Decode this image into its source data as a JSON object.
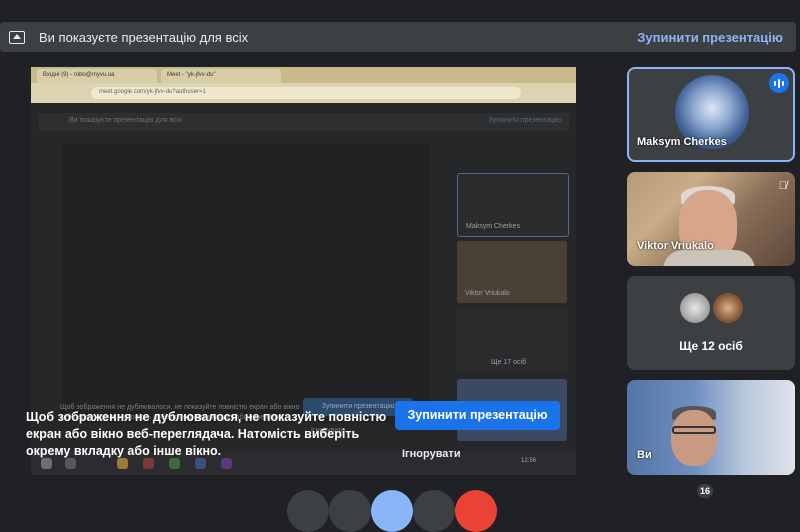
{
  "banner": {
    "text": "Ви показуєте презентацію для всіх",
    "stop_label": "Зупинити презентацію"
  },
  "shared_screen": {
    "tabs": [
      "Вхідні (9) - robo@myvu.ua",
      "Meet - \"yk-jfvv-du\""
    ],
    "url": "meet.google.com/yk-jfvv-du?authuser=1",
    "inner_banner_text": "Ви показуєте презентацію для всіх",
    "inner_stop_label": "Зупинити презентацію",
    "inner_tiles": [
      "Maksym Cherkes",
      "Viktor Vriukalo",
      "Ще 17 осіб",
      ""
    ],
    "inner_message": "Щоб зображення не дублювалося, не показуйте повністю екран або вікно веб-переглядача. Натомість виберіть окрему вкладку або інше вікно.",
    "inner_button": "Зупинити презентацію",
    "inner_ignore": "Ігнорувати",
    "clock": "12:56"
  },
  "overlay": {
    "message": "Щоб зображення не дублювалося, не показуйте повністю екран або вікно веб-переглядача. Натомість виберіть окрему вкладку або інше вікно.",
    "stop_button": "Зупинити презентацію",
    "ignore": "Ігнорувати"
  },
  "participants": [
    {
      "name": "Maksym Cherkes",
      "speaking": true
    },
    {
      "name": "Viktor Vriukalo",
      "muted": true
    },
    {
      "name": "Ще 12 осіб"
    },
    {
      "name": "Ви"
    }
  ],
  "controls": {
    "participant_count": "16"
  },
  "colors": {
    "accent": "#1a73e8",
    "link": "#8ab4f8",
    "background": "#202124",
    "tile": "#3c4043"
  }
}
